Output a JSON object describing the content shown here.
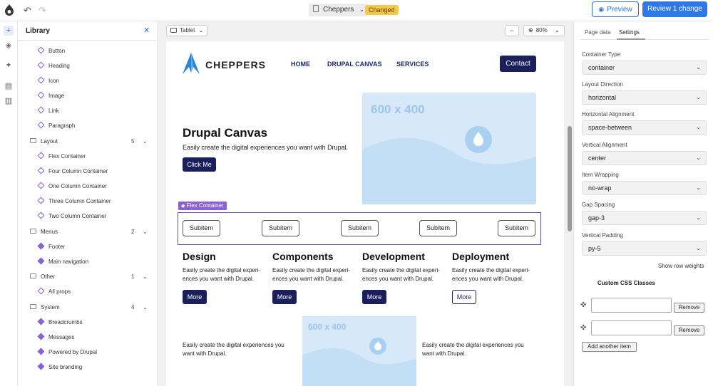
{
  "topbar": {
    "page_name": "Cheppers",
    "changed_badge": "Changed",
    "preview_label": "Preview",
    "review_label": "Review 1 change"
  },
  "library": {
    "title": "Library",
    "items": [
      "Button",
      "Heading",
      "Icon",
      "Image",
      "Link",
      "Paragraph"
    ],
    "folders": [
      {
        "name": "Layout",
        "count": "5",
        "items": [
          "Flex Container",
          "Four Column Container",
          "One Column Container",
          "Three Column Container",
          "Two Column Container"
        ]
      },
      {
        "name": "Menus",
        "count": "2",
        "items": [
          "Footer",
          "Main navigation"
        ]
      },
      {
        "name": "Other",
        "count": "1",
        "items": [
          "All props"
        ]
      },
      {
        "name": "System",
        "count": "4",
        "items": [
          "Breadcrumbs",
          "Messages",
          "Powered by Drupal",
          "Site branding"
        ]
      }
    ]
  },
  "canvas": {
    "device": "Tablet",
    "zoom": "80%"
  },
  "page": {
    "brand": "CHEPPERS",
    "nav": [
      "HOME",
      "DRUPAL CANVAS",
      "SERVICES"
    ],
    "contact": "Contact",
    "hero_title": "Drupal Canvas",
    "hero_text": "Easily create the digital experiences you want with Drupal.",
    "hero_button": "Click Me",
    "image_label": "600 x 400",
    "flex_tag": "Flex Container",
    "subitems": [
      "Subitem",
      "Subitem",
      "Subitem",
      "Subitem",
      "Subitem"
    ],
    "cards": [
      {
        "title": "Design",
        "text": "Easily create the digital experi-ences you want with Drupal.",
        "button": "More"
      },
      {
        "title": "Components",
        "text": "Easily create the digital experi-ences you want with Drupal.",
        "button": "More"
      },
      {
        "title": "Development",
        "text": "Easily create the digital experi-ences you want with Drupal.",
        "button": "More"
      },
      {
        "title": "Deployment",
        "text": "Easily create the digital experi-ences you want with Drupal.",
        "button": "More"
      }
    ],
    "bottom_text_left": "Easily create the digital experiences you want with Drupal.",
    "bottom_text_right": "Easily create the digital experiences you want with Drupal.",
    "bottom_image_label": "600 x 400"
  },
  "settings": {
    "tab_page_data": "Page data",
    "tab_settings": "Settings",
    "fields": [
      {
        "label": "Container Type",
        "value": "container"
      },
      {
        "label": "Layout Direction",
        "value": "horizontal"
      },
      {
        "label": "Horizontal Alignment",
        "value": "space-between"
      },
      {
        "label": "Vertical Alignment",
        "value": "center"
      },
      {
        "label": "Item Wrapping",
        "value": "no-wrap"
      },
      {
        "label": "Gap Spacing",
        "value": "gap-3"
      },
      {
        "label": "Vertical Padding",
        "value": "py-5"
      }
    ],
    "show_row_weights": "Show row weights",
    "custom_css_title": "Custom CSS Classes",
    "remove_label": "Remove",
    "add_item_label": "Add another item"
  }
}
